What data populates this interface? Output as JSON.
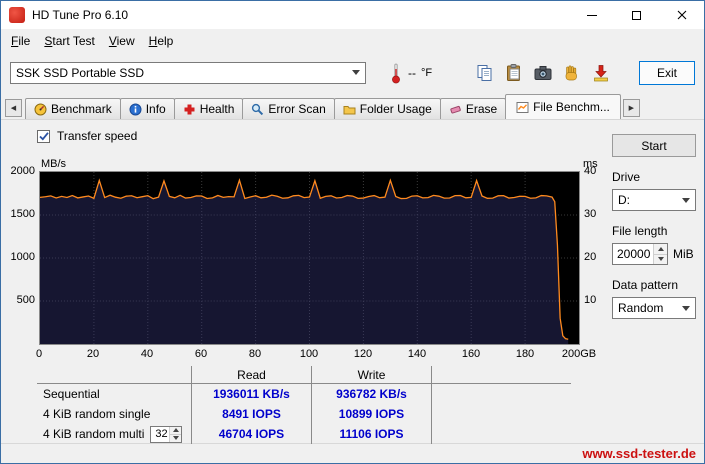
{
  "window": {
    "title": "HD Tune Pro 6.10"
  },
  "menu": {
    "items": [
      {
        "label": "File"
      },
      {
        "label": "Start Test"
      },
      {
        "label": "View"
      },
      {
        "label": "Help"
      }
    ]
  },
  "toolbar": {
    "drive_combo": {
      "value": "SSK SSD Portable SSD"
    },
    "temperature": {
      "value": "--",
      "unit": "°F",
      "icon": "thermometer-icon"
    },
    "icons": [
      "copy-icon",
      "clipboard-icon",
      "camera-icon",
      "hand-icon",
      "save-icon"
    ],
    "exit_label": "Exit"
  },
  "tabs": {
    "scroll_left_glyph": "◀",
    "scroll_right_glyph": "▶",
    "items": [
      {
        "label": "Benchmark",
        "icon": "gauge-icon",
        "active": false
      },
      {
        "label": "Info",
        "icon": "info-icon",
        "active": false
      },
      {
        "label": "Health",
        "icon": "health-cross-icon",
        "active": false
      },
      {
        "label": "Error Scan",
        "icon": "magnifier-icon",
        "active": false
      },
      {
        "label": "Folder Usage",
        "icon": "folder-icon",
        "active": false
      },
      {
        "label": "Erase",
        "icon": "eraser-icon",
        "active": false
      },
      {
        "label": "File Benchm...",
        "icon": "file-benchmark-icon",
        "active": true
      }
    ]
  },
  "panel": {
    "transfer_speed_label": "Transfer speed",
    "start_button": "Start",
    "drive_label": "Drive",
    "drive_value": "D:",
    "file_length_label": "File length",
    "file_length_value": "20000",
    "file_length_unit": "MiB",
    "data_pattern_label": "Data pattern",
    "data_pattern_value": "Random"
  },
  "chart_data": {
    "type": "line",
    "x_axis": {
      "min": 0,
      "max": 200,
      "ticks": [
        {
          "v": 0,
          "label": "0"
        },
        {
          "v": 20,
          "label": "20"
        },
        {
          "v": 40,
          "label": "40"
        },
        {
          "v": 60,
          "label": "60"
        },
        {
          "v": 80,
          "label": "80"
        },
        {
          "v": 100,
          "label": "100"
        },
        {
          "v": 120,
          "label": "120"
        },
        {
          "v": 140,
          "label": "140"
        },
        {
          "v": 160,
          "label": "160"
        },
        {
          "v": 180,
          "label": "180"
        },
        {
          "v": 200,
          "label": "200GB"
        }
      ]
    },
    "y_left": {
      "label": "MB/s",
      "min": 0,
      "max": 2000,
      "ticks": [
        {
          "v": 2000,
          "label": "2000"
        },
        {
          "v": 1500,
          "label": "1500"
        },
        {
          "v": 1000,
          "label": "1000"
        },
        {
          "v": 500,
          "label": "500"
        }
      ]
    },
    "y_right": {
      "label": "ms",
      "min": 0,
      "max": 40,
      "ticks": [
        {
          "v": 40,
          "label": "40"
        },
        {
          "v": 30,
          "label": "30"
        },
        {
          "v": 20,
          "label": "20"
        },
        {
          "v": 10,
          "label": "10"
        }
      ]
    },
    "grid": true,
    "legend": "none",
    "series": [
      {
        "name": "Transfer speed (read)",
        "axis": "left",
        "color": "#ff8a1e",
        "fill": "rgba(58,58,128,0.38)",
        "points": [
          [
            0,
            1705
          ],
          [
            2,
            1712
          ],
          [
            4,
            1722
          ],
          [
            6,
            1698
          ],
          [
            8,
            1716
          ],
          [
            10,
            1704
          ],
          [
            12,
            1726
          ],
          [
            14,
            1699
          ],
          [
            16,
            1710
          ],
          [
            18,
            1721
          ],
          [
            20,
            1694
          ],
          [
            22,
            1902
          ],
          [
            24,
            1703
          ],
          [
            26,
            1730
          ],
          [
            28,
            1707
          ],
          [
            30,
            1695
          ],
          [
            32,
            1719
          ],
          [
            34,
            1724
          ],
          [
            36,
            1701
          ],
          [
            38,
            1713
          ],
          [
            40,
            1725
          ],
          [
            42,
            1690
          ],
          [
            44,
            1708
          ],
          [
            46,
            1896
          ],
          [
            48,
            1716
          ],
          [
            50,
            1700
          ],
          [
            52,
            1729
          ],
          [
            54,
            1697
          ],
          [
            56,
            1703
          ],
          [
            58,
            1722
          ],
          [
            60,
            1721
          ],
          [
            62,
            1692
          ],
          [
            64,
            1699
          ],
          [
            66,
            1727
          ],
          [
            68,
            1705
          ],
          [
            70,
            1714
          ],
          [
            72,
            1711
          ],
          [
            74,
            1905
          ],
          [
            76,
            1692
          ],
          [
            78,
            1709
          ],
          [
            80,
            1724
          ],
          [
            82,
            1700
          ],
          [
            84,
            1706
          ],
          [
            86,
            1731
          ],
          [
            88,
            1718
          ],
          [
            90,
            1695
          ],
          [
            92,
            1700
          ],
          [
            94,
            1723
          ],
          [
            96,
            1728
          ],
          [
            98,
            1702
          ],
          [
            100,
            1709
          ],
          [
            102,
            1898
          ],
          [
            104,
            1695
          ],
          [
            106,
            1717
          ],
          [
            108,
            1723
          ],
          [
            110,
            1698
          ],
          [
            112,
            1704
          ],
          [
            114,
            1726
          ],
          [
            116,
            1720
          ],
          [
            118,
            1693
          ],
          [
            120,
            1697
          ],
          [
            122,
            1715
          ],
          [
            124,
            1726
          ],
          [
            126,
            1701
          ],
          [
            128,
            1708
          ],
          [
            130,
            1903
          ],
          [
            132,
            1715
          ],
          [
            134,
            1691
          ],
          [
            136,
            1693
          ],
          [
            138,
            1720
          ],
          [
            140,
            1724
          ],
          [
            142,
            1699
          ],
          [
            144,
            1702
          ],
          [
            146,
            1728
          ],
          [
            148,
            1719
          ],
          [
            150,
            1696
          ],
          [
            152,
            1698
          ],
          [
            154,
            1725
          ],
          [
            156,
            1727
          ],
          [
            158,
            1700
          ],
          [
            160,
            1705
          ],
          [
            162,
            1900
          ],
          [
            164,
            1721
          ],
          [
            166,
            1694
          ],
          [
            168,
            1696
          ],
          [
            170,
            1723
          ],
          [
            172,
            1725
          ],
          [
            174,
            1697
          ],
          [
            176,
            1703
          ],
          [
            178,
            1718
          ],
          [
            180,
            1717
          ],
          [
            182,
            1695
          ],
          [
            184,
            1699
          ],
          [
            186,
            1726
          ],
          [
            188,
            1722
          ],
          [
            190,
            1708
          ],
          [
            191,
            1655
          ],
          [
            192,
            1150
          ],
          [
            193,
            300
          ],
          [
            194,
            95
          ],
          [
            195,
            62
          ],
          [
            196,
            55
          ]
        ]
      }
    ]
  },
  "results": {
    "headers": [
      "Read",
      "Write"
    ],
    "rows": [
      {
        "label": "Sequential",
        "read": "1936011 KB/s",
        "write": "936782 KB/s"
      },
      {
        "label": "4 KiB random single",
        "read": "8491 IOPS",
        "write": "10899 IOPS"
      },
      {
        "label": "4 KiB random multi",
        "queue_depth": "32",
        "read": "46704 IOPS",
        "write": "11106 IOPS"
      }
    ]
  },
  "statusbar": {
    "website": "www.ssd-tester.de"
  },
  "colors": {
    "accent_border": "#0078d7",
    "chart_line": "#ff8a1e",
    "value_text": "#0000cc",
    "website_text": "#cc1111"
  }
}
